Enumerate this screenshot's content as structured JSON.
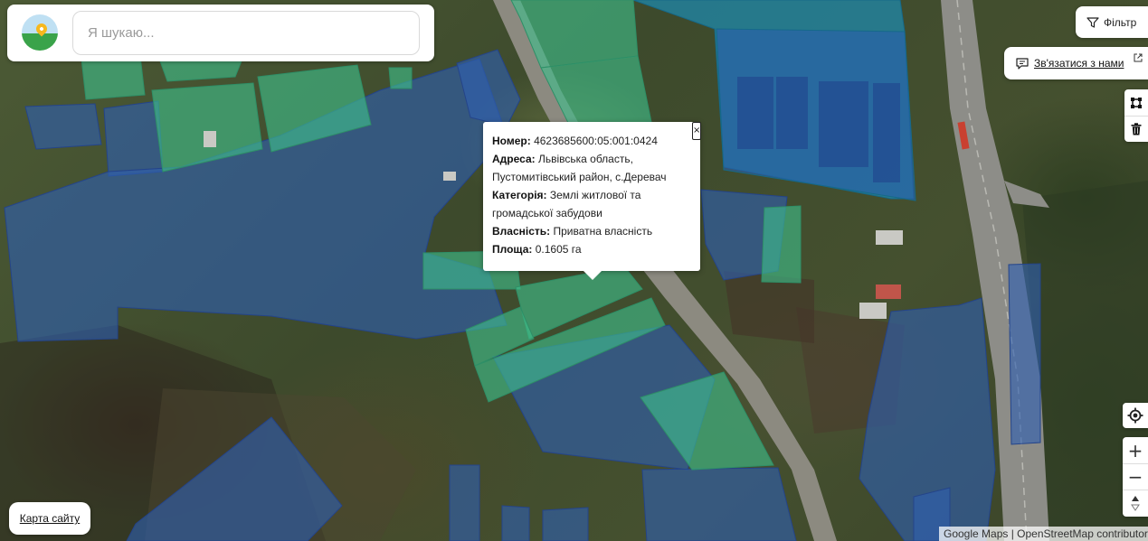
{
  "search": {
    "placeholder": "Я шукаю..."
  },
  "toolbar": {
    "filter_label": "Фільтр",
    "contact_label": "Зв'язатися з нами",
    "sitemap_label": "Карта сайту",
    "zoom_in_label": "+",
    "zoom_out_label": "−"
  },
  "popup": {
    "number_label": "Номер:",
    "number_value": "4623685600:05:001:0424",
    "address_label": "Адреса:",
    "address_value_line1": "Львівська область,",
    "address_value_line2": "Пустомитівський район, с.Деревач",
    "category_label": "Категорія:",
    "category_value_line1": "Землі житлової та",
    "category_value_line2": "громадської забудови",
    "ownership_label": "Власність:",
    "ownership_value": "Приватна власність",
    "area_label": "Площа:",
    "area_value": "0.1605 га",
    "close_label": "×"
  },
  "attribution": "Google Maps | OpenStreetMap contributor",
  "map_layers": {
    "parcel_colors": {
      "private": "#2f5fb0",
      "residential": "#3fbf8a",
      "large": "#1d8ab0"
    },
    "icons": {
      "filter": "funnel-icon",
      "contact": "chat-bubble-icon",
      "external": "external-link-icon",
      "draw": "polygon-draw-icon",
      "delete": "trash-icon",
      "locate": "crosshair-icon",
      "reset": "compass-north-icon"
    }
  }
}
